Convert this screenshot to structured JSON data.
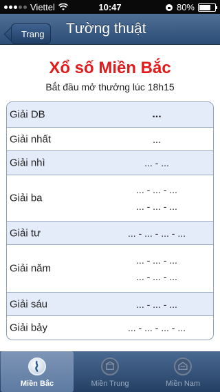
{
  "status_bar": {
    "carrier": "Viettel",
    "time": "10:47",
    "battery": "80%",
    "battery_level": 0.8
  },
  "navbar": {
    "back_label": "Trang chủ",
    "title": "Tường thuật"
  },
  "header": {
    "title": "Xổ số Miền Bắc",
    "subtitle": "Bắt đầu mở thưởng lúc 18h15"
  },
  "prizes": [
    {
      "label": "Giải DB",
      "values": [
        "..."
      ]
    },
    {
      "label": "Giải nhất",
      "values": [
        "..."
      ]
    },
    {
      "label": "Giải nhì",
      "values": [
        "... - ..."
      ]
    },
    {
      "label": "Giải ba",
      "values": [
        "... - ... - ...",
        "... - ... - ..."
      ]
    },
    {
      "label": "Giải tư",
      "values": [
        "... - ... - ... - ..."
      ]
    },
    {
      "label": "Giải năm",
      "values": [
        "... - ... - ...",
        "... - ... - ..."
      ]
    },
    {
      "label": "Giải sáu",
      "values": [
        "... - ... - ..."
      ]
    },
    {
      "label": "Giải bảy",
      "values": [
        "... - ... - ... - ..."
      ]
    }
  ],
  "tabs": [
    {
      "label": "Miền Bắc",
      "active": true
    },
    {
      "label": "Miền Trung",
      "active": false
    },
    {
      "label": "Miền Nam",
      "active": false
    }
  ],
  "colors": {
    "heading": "#e11b1b",
    "navbar": "#3c5c84",
    "row_shaded": "#e3ecf8"
  }
}
